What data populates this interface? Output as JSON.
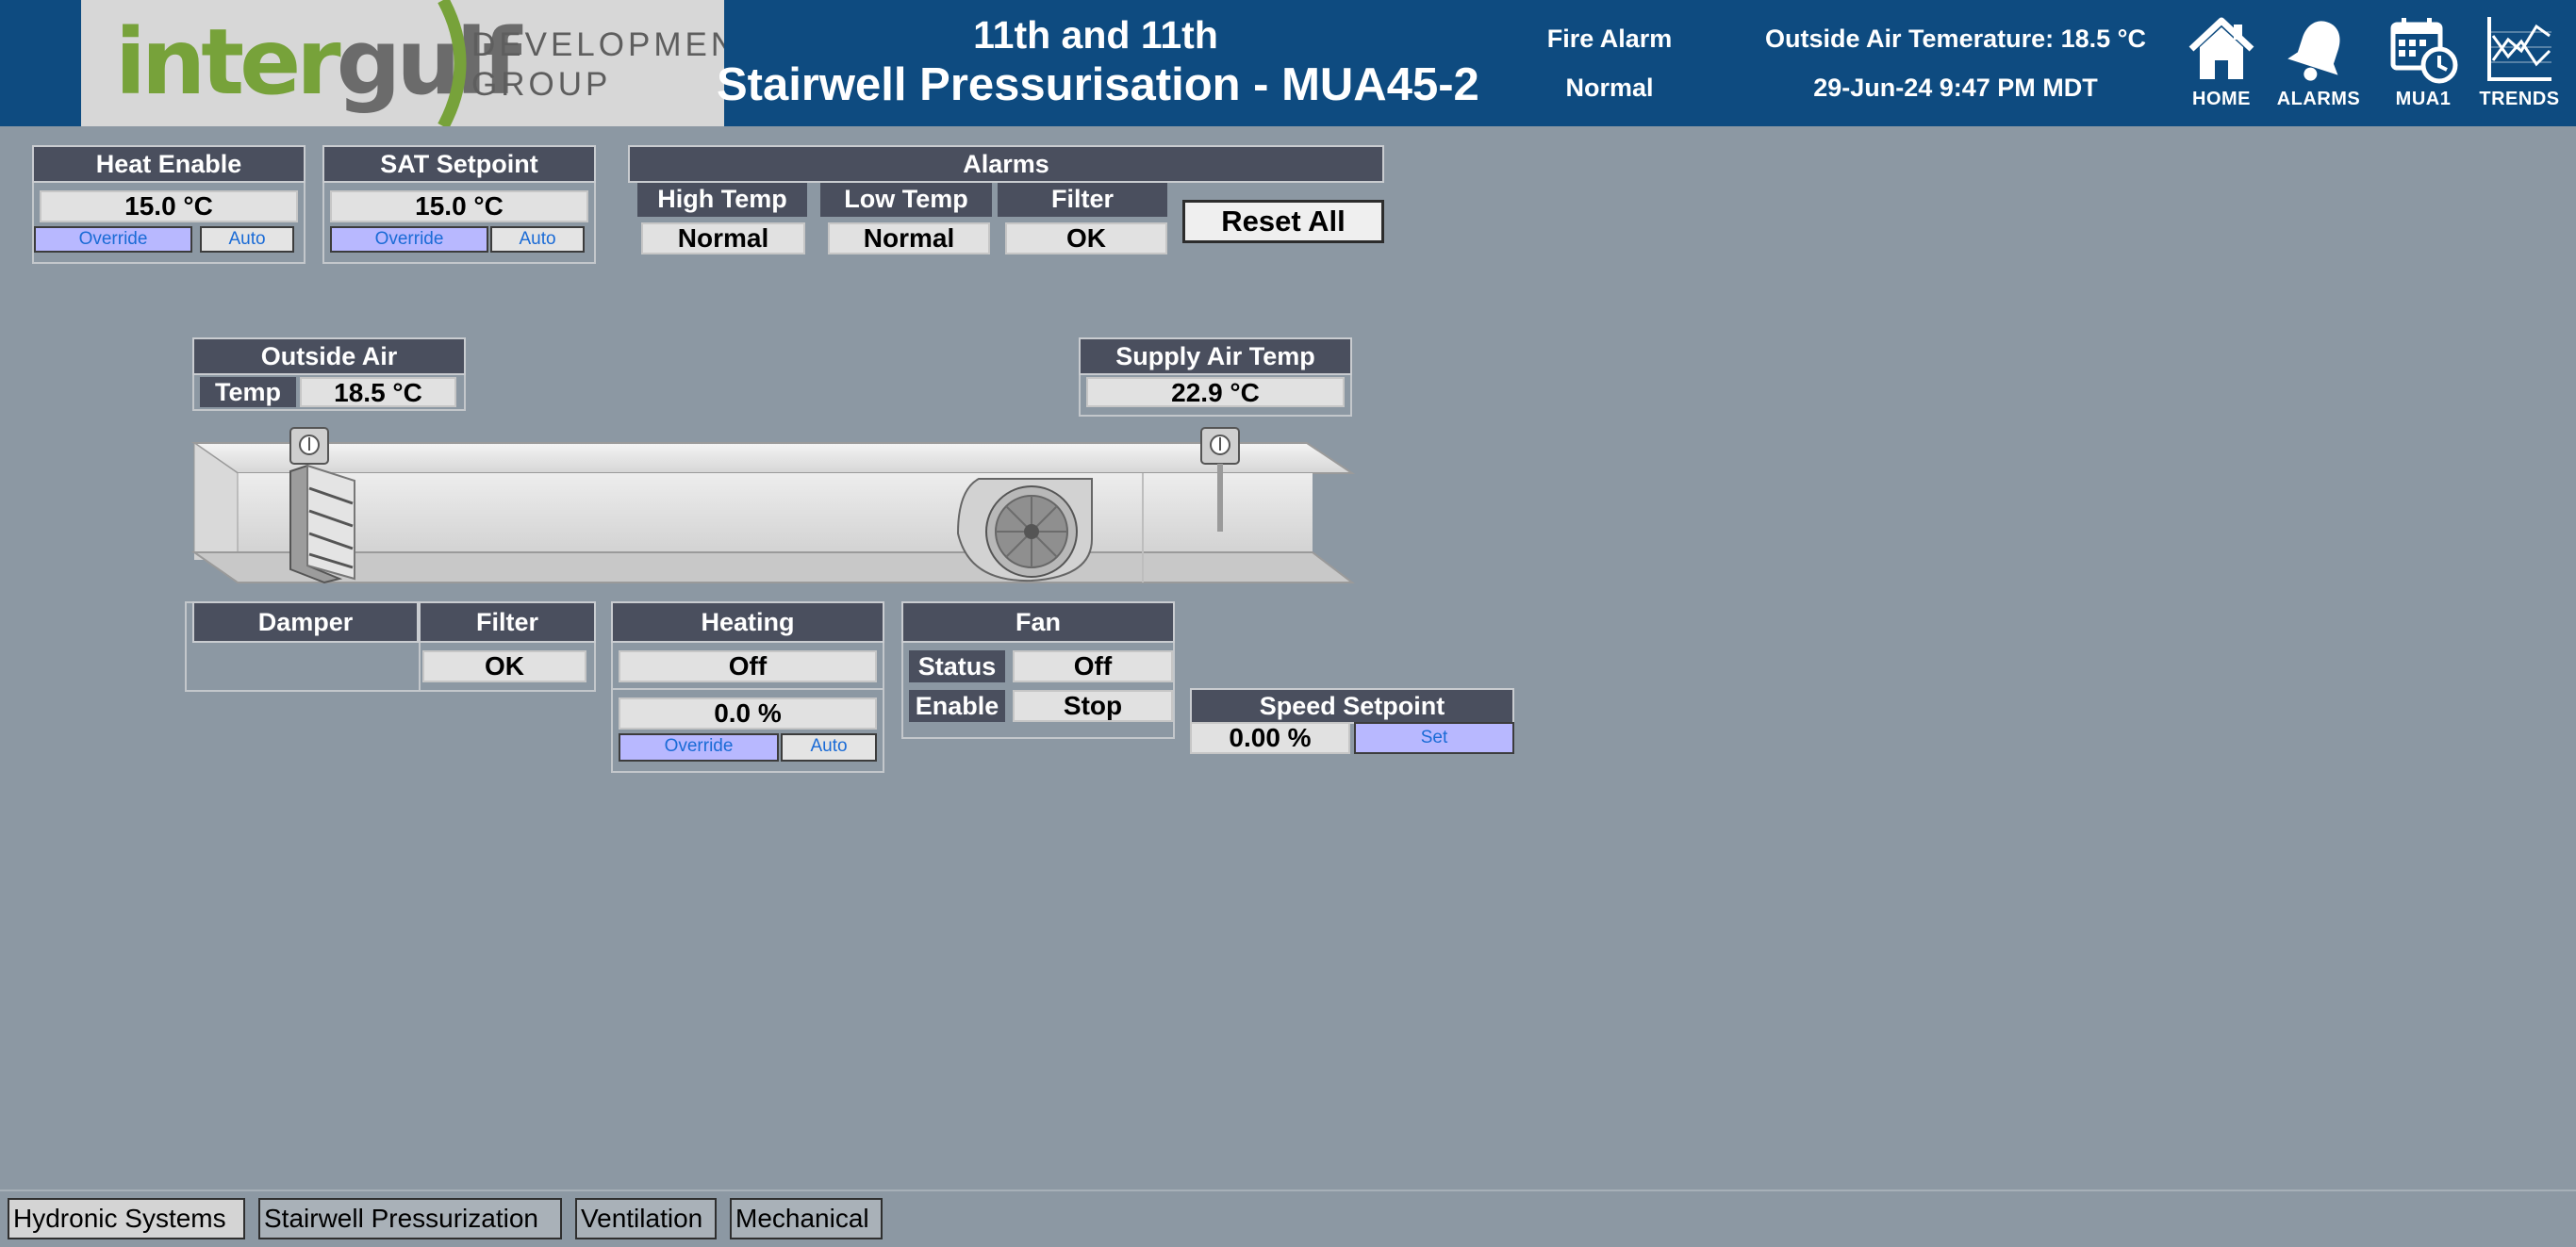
{
  "header": {
    "logo": {
      "brand_part1": "inter",
      "brand_part2": "gulf",
      "sub_line1": "DEVELOPMENT",
      "sub_line2": "GROUP"
    },
    "title_line1": "11th and 11th",
    "title_line2": "Stairwell Pressurisation - MUA45-2",
    "fire_alarm_label": "Fire Alarm",
    "fire_alarm_status": "Normal",
    "outside_air_text": "Outside Air Temerature: 18.5 °C",
    "datetime": "29-Jun-24 9:47 PM MDT",
    "nav": [
      {
        "label": "HOME",
        "icon": "home-icon"
      },
      {
        "label": "ALARMS",
        "icon": "bell-icon"
      },
      {
        "label": "MUA1",
        "icon": "calendar-clock-icon"
      },
      {
        "label": "TRENDS",
        "icon": "trend-chart-icon"
      }
    ]
  },
  "heat_enable": {
    "title": "Heat Enable",
    "value": "15.0 °C",
    "override_label": "Override",
    "auto_label": "Auto"
  },
  "sat_setpoint": {
    "title": "SAT Setpoint",
    "value": "15.0 °C",
    "override_label": "Override",
    "auto_label": "Auto"
  },
  "alarms": {
    "title": "Alarms",
    "items": [
      {
        "label": "High Temp",
        "status": "Normal"
      },
      {
        "label": "Low Temp",
        "status": "Normal"
      },
      {
        "label": "Filter",
        "status": "OK"
      }
    ],
    "reset_label": "Reset All"
  },
  "outside_air": {
    "title": "Outside Air",
    "temp_label": "Temp",
    "temp_value": "18.5 °C"
  },
  "supply_air": {
    "title": "Supply Air Temp",
    "value": "22.9 °C"
  },
  "damper": {
    "title": "Damper"
  },
  "filter": {
    "title": "Filter",
    "status": "OK"
  },
  "heating": {
    "title": "Heating",
    "status": "Off",
    "output": "0.0 %",
    "override_label": "Override",
    "auto_label": "Auto"
  },
  "fan": {
    "title": "Fan",
    "status_label": "Status",
    "status_value": "Off",
    "enable_label": "Enable",
    "enable_value": "Stop"
  },
  "speed_setpoint": {
    "title": "Speed Setpoint",
    "value": "0.00 %",
    "set_label": "Set"
  },
  "tabs": [
    {
      "label": "Hydronic Systems",
      "active": true
    },
    {
      "label": "Stairwell Pressurization",
      "active": false
    },
    {
      "label": "Ventilation",
      "active": false
    },
    {
      "label": "Mechanical",
      "active": false
    }
  ],
  "colors": {
    "header_bg": "#0e4b80",
    "page_bg": "#8c98a3",
    "panel_header": "#4a4f5e",
    "override_button": "#b8b8ff",
    "logo_green": "#77a23a"
  }
}
